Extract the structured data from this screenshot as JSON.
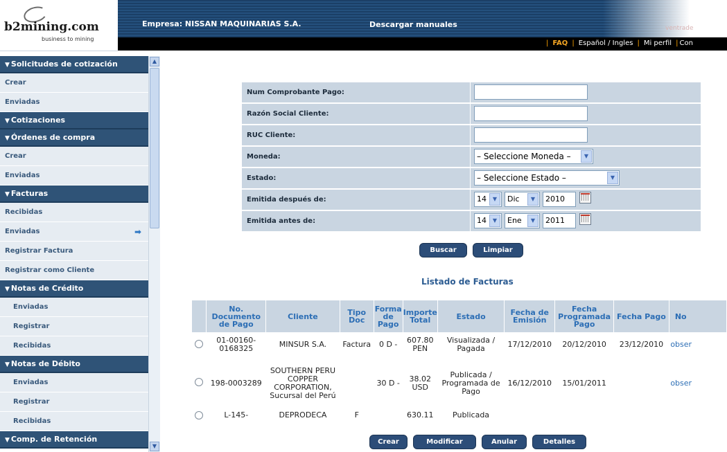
{
  "header": {
    "logo_text": "b2mining.com",
    "logo_tagline": "business to mining",
    "topline": "",
    "empresa": "Empresa: NISSAN MAQUINARIAS S.A.",
    "descargar": "Descargar manuales",
    "ventrade": "ventrade",
    "links": {
      "faq": "FAQ",
      "idioma": "Español / Ingles",
      "perfil": "Mi perfil",
      "con": "Con"
    }
  },
  "sidebar": {
    "s1": {
      "title": "Solicitudes de cotización",
      "items": [
        "Crear",
        "Enviadas"
      ]
    },
    "s2": {
      "title": "Cotizaciones"
    },
    "s3": {
      "title": "Órdenes de compra",
      "items": [
        "Crear",
        "Enviadas"
      ]
    },
    "s4": {
      "title": "Facturas",
      "items": [
        "Recibidas",
        "Enviadas",
        "Registrar Factura",
        "Registrar como Cliente"
      ]
    },
    "s5": {
      "title": "Notas de Crédito",
      "items": [
        "Enviadas",
        "Registrar",
        "Recibidas"
      ]
    },
    "s6": {
      "title": "Notas de Débito",
      "items": [
        "Enviadas",
        "Registrar",
        "Recibidas"
      ]
    },
    "s7": {
      "title": "Comp. de Retención"
    }
  },
  "form": {
    "num_comprobante": "Num Comprobante Pago:",
    "razon_social": "Razón Social Cliente:",
    "ruc": "RUC Cliente:",
    "moneda": "Moneda:",
    "moneda_value": "– Seleccione Moneda –",
    "estado": "Estado:",
    "estado_value": "– Seleccione Estado –",
    "emitida_despues": "Emitida después de:",
    "despues": {
      "dia": "14",
      "mes": "Dic",
      "anio": "2010"
    },
    "emitida_antes": "Emitida antes de:",
    "antes": {
      "dia": "14",
      "mes": "Ene",
      "anio": "2011"
    },
    "buscar": "Buscar",
    "limpiar": "Limpiar"
  },
  "list": {
    "title": "Listado de Facturas",
    "columns": [
      "No. Documento de Pago",
      "Cliente",
      "Tipo Doc",
      "Forma de Pago",
      "Importe Total",
      "Estado",
      "Fecha de Emisión",
      "Fecha Programada Pago",
      "Fecha Pago",
      "No"
    ],
    "rows": [
      {
        "doc": "01-00160-0168325",
        "cliente": "MINSUR S.A.",
        "tipo": "Factura",
        "forma": "0 D -",
        "importe": "607.80 PEN",
        "estado": "Visualizada / Pagada",
        "emision": "17/12/2010",
        "programada": "20/12/2010",
        "pago": "23/12/2010",
        "obs": "obser"
      },
      {
        "doc": "198-0003289",
        "cliente": "SOUTHERN PERU COPPER CORPORATION, Sucursal del Perú",
        "tipo": "",
        "forma": "30 D -",
        "importe": "38.02 USD",
        "estado": "Publicada / Programada de Pago",
        "emision": "16/12/2010",
        "programada": "15/01/2011",
        "pago": "",
        "obs": "obser"
      },
      {
        "doc": "L-145-",
        "cliente": "DEPRODECA",
        "tipo": "F",
        "forma": "",
        "importe": "630.11",
        "estado": "Publicada",
        "emision": "",
        "programada": "",
        "pago": "",
        "obs": ""
      }
    ]
  },
  "actions": {
    "crear": "Crear",
    "modificar": "Modificar",
    "anular": "Anular",
    "detalles": "Detalles"
  }
}
